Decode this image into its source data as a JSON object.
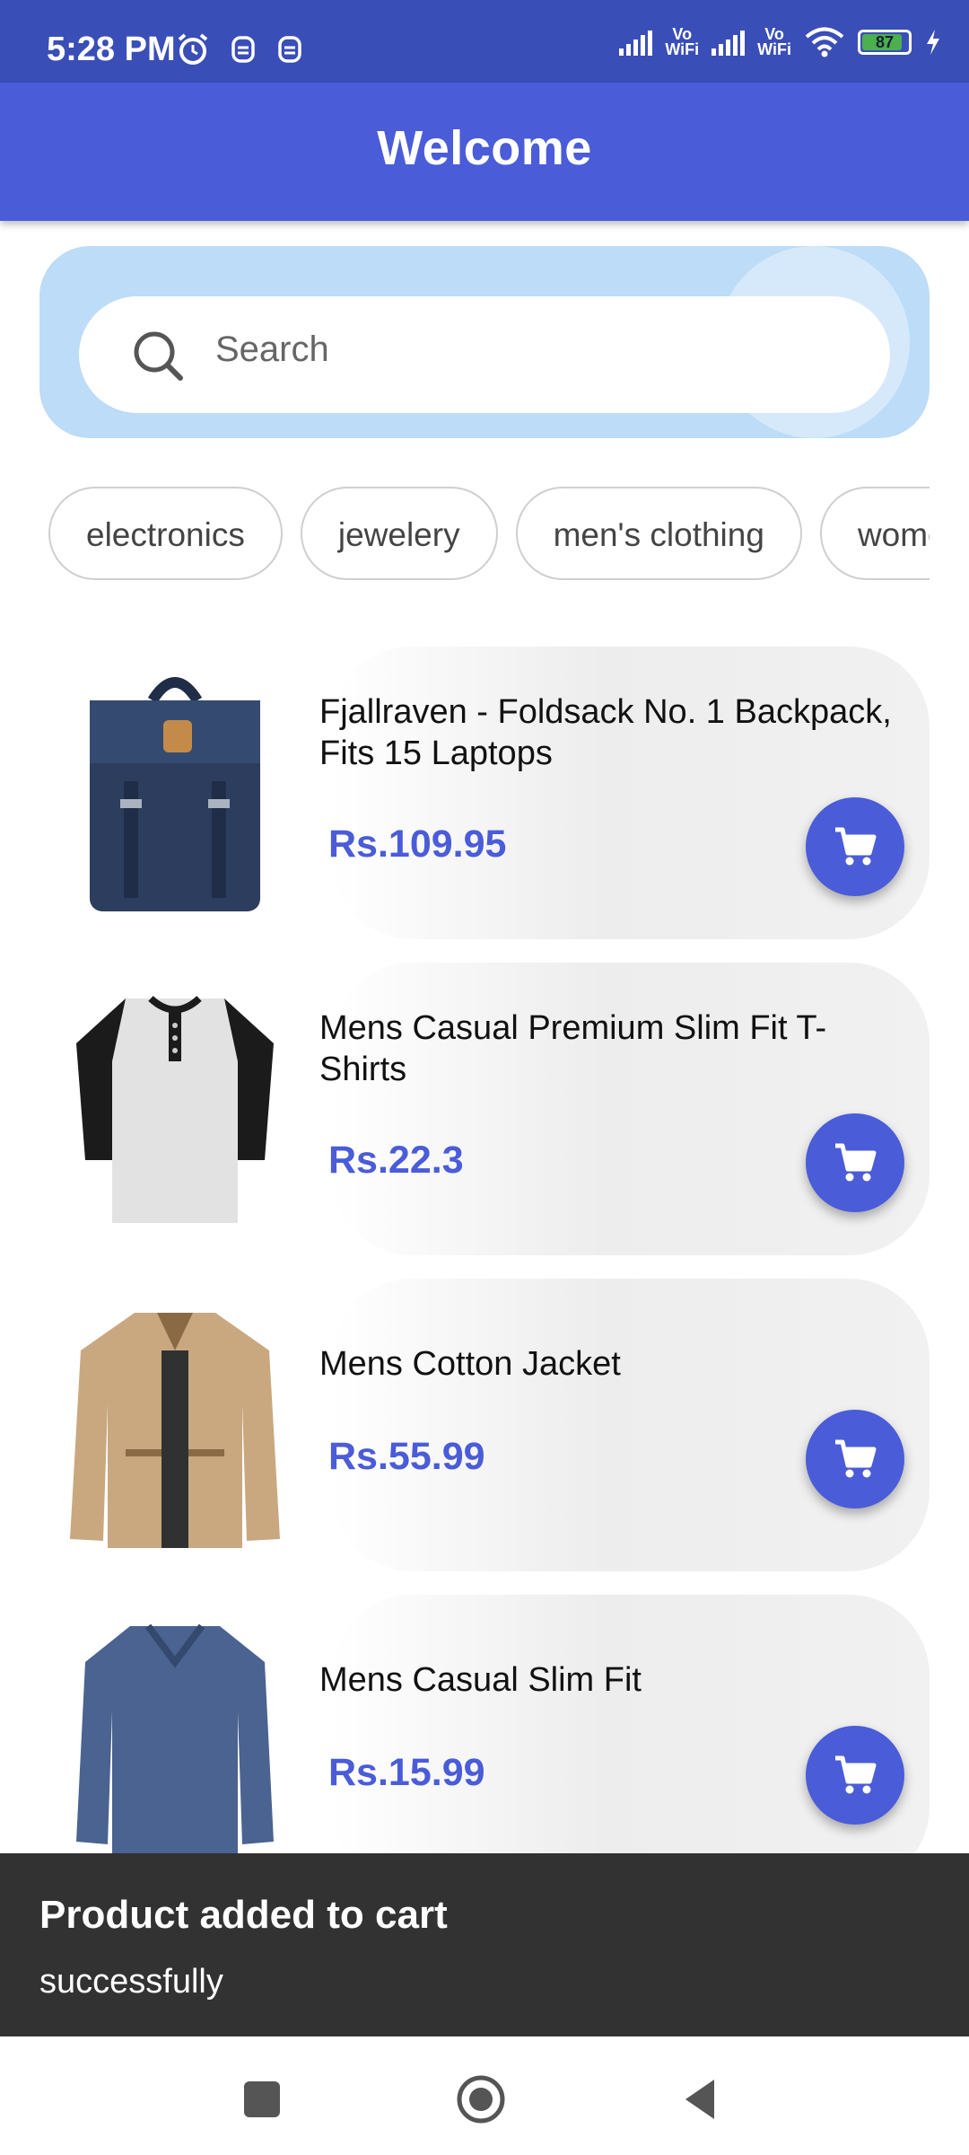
{
  "status_bar": {
    "time": "5:28 PM",
    "icons_left": [
      "alarm-icon",
      "notification-icon",
      "notification-icon"
    ],
    "signal1_label": "Vo\nWiFi",
    "signal2_label": "Vo\nWiFi",
    "battery_level": "87"
  },
  "app_bar": {
    "title": "Welcome"
  },
  "search": {
    "placeholder": "Search",
    "value": ""
  },
  "categories": [
    "electronics",
    "jewelery",
    "men's clothing",
    "women's clothing"
  ],
  "products": [
    {
      "name": "Fjallraven - Foldsack No. 1 Backpack, Fits 15 Laptops",
      "price": "Rs.109.95",
      "image": "backpack"
    },
    {
      "name": "Mens Casual Premium Slim Fit T-Shirts",
      "price": "Rs.22.3",
      "image": "tshirt"
    },
    {
      "name": "Mens Cotton Jacket",
      "price": "Rs.55.99",
      "image": "jacket"
    },
    {
      "name": "Mens Casual Slim Fit",
      "price": "Rs.15.99",
      "image": "longsleeve"
    }
  ],
  "snackbar": {
    "line1": "Product added to cart",
    "line2": "successfully"
  },
  "colors": {
    "primary": "#4a5cd8",
    "status_bar": "#3a4eb8",
    "search_panel": "#bcdcf7",
    "snackbar": "#323232"
  }
}
